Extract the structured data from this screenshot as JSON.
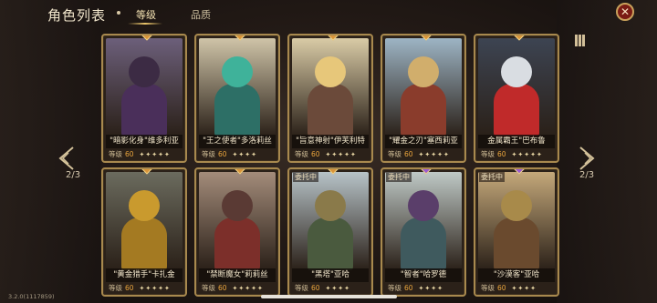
{
  "header": {
    "title": "角色列表",
    "tabs": [
      {
        "label": "等级",
        "active": true
      },
      {
        "label": "品质",
        "active": false
      }
    ]
  },
  "pagination": {
    "left": "2/3",
    "right": "2/3"
  },
  "version": "3.2.0(1117859)",
  "colors": {
    "accent": "#e9c46a",
    "level_value": "#e8a43c",
    "close": "#7a1c14"
  },
  "level_label": "等级",
  "cards_row1": [
    {
      "name": "\"暗影化身\"维多利亚",
      "level": "60",
      "stars": "✦✦✦✦✦",
      "gem": "#d8943a",
      "sky": "#6c5f7a",
      "head": "#3c2b44",
      "body": "#4a2f5a"
    },
    {
      "name": "\"王之使者\"多洛莉丝",
      "level": "60",
      "stars": "✦✦✦✦",
      "gem": "#d8943a",
      "sky": "#cfc4a8",
      "head": "#3fb29a",
      "body": "#2d6f66"
    },
    {
      "name": "\"旨意神射\"伊芙利特",
      "level": "60",
      "stars": "✦✦✦✦✦",
      "gem": "#d8943a",
      "sky": "#d9cba6",
      "head": "#e7c77a",
      "body": "#6b4a3a"
    },
    {
      "name": "\"耀金之刃\"塞西莉亚",
      "level": "60",
      "stars": "✦✦✦✦✦",
      "gem": "#d8943a",
      "sky": "#9db4c4",
      "head": "#d1ae6c",
      "body": "#8a3c2c"
    },
    {
      "name": "金属霸王\"巴布鲁",
      "level": "60",
      "stars": "✦✦✦✦✦",
      "gem": "#d8943a",
      "sky": "#3d4452",
      "head": "#d9dde2",
      "body": "#c02a2a"
    }
  ],
  "cards_row2": [
    {
      "name": "\"黄金猎手\"卡扎金",
      "level": "60",
      "stars": "✦✦✦✦✦",
      "gem": "#d8943a",
      "sky": "#6b6b5e",
      "head": "#c99a2e",
      "body": "#a47a22",
      "commission": ""
    },
    {
      "name": "\"禁断魔女\"莉莉丝",
      "level": "60",
      "stars": "✦✦✦✦✦",
      "gem": "#d8943a",
      "sky": "#a38c7a",
      "head": "#5a3a34",
      "body": "#7c2f2a",
      "commission": ""
    },
    {
      "name": "\"黑塔\"亚哈",
      "level": "60",
      "stars": "✦✦✦✦",
      "gem": "#d8943a",
      "sky": "#b7c3c8",
      "head": "#8a7a4a",
      "body": "#4a5a3e",
      "commission": "委托中"
    },
    {
      "name": "\"智者\"哈罗德",
      "level": "60",
      "stars": "✦✦✦✦",
      "gem": "#9a5ad0",
      "sky": "#bfc9c6",
      "head": "#5a3e6a",
      "body": "#3f5a5e",
      "commission": "委托中"
    },
    {
      "name": "\"沙漠客\"亚哈",
      "level": "60",
      "stars": "✦✦✦✦",
      "gem": "#9a5ad0",
      "sky": "#c4a87a",
      "head": "#a88a4a",
      "body": "#6a4a2e",
      "commission": "委托中"
    }
  ]
}
